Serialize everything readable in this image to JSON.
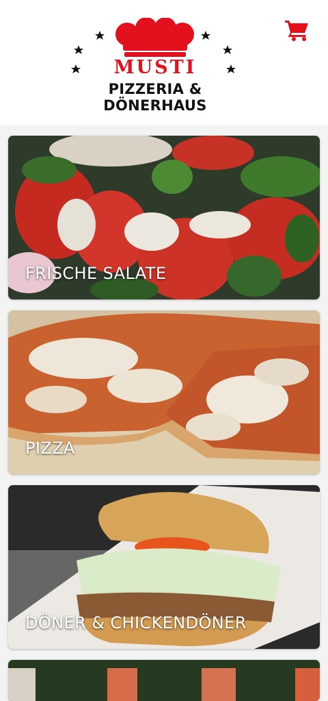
{
  "header": {
    "brand_name": "MUSTI",
    "brand_subtitle": "PIZZERIA & DÖNERHAUS",
    "cart_icon": "shopping-cart-icon",
    "accent_color": "#e3101e"
  },
  "categories": [
    {
      "label": "FRISCHE SALATE"
    },
    {
      "label": "PIZZA"
    },
    {
      "label": "DÖNER & CHICKENDÖNER"
    }
  ]
}
